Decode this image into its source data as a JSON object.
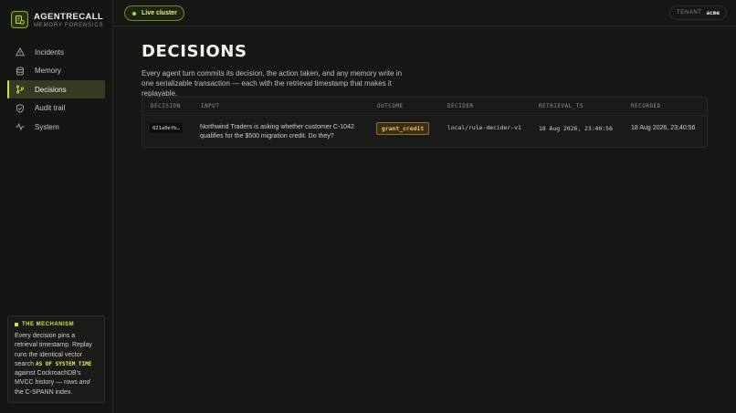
{
  "brand": {
    "name": "AGENTRECALL",
    "subtitle": "MEMORY FORENSICS",
    "accent": "#c8e63c"
  },
  "sidebar": {
    "items": [
      {
        "label": "Incidents",
        "icon": "warning-icon",
        "active": false
      },
      {
        "label": "Memory",
        "icon": "database-icon",
        "active": false
      },
      {
        "label": "Decisions",
        "icon": "git-branch-icon",
        "active": true
      },
      {
        "label": "Audit trail",
        "icon": "shield-check-icon",
        "active": false
      },
      {
        "label": "System",
        "icon": "activity-icon",
        "active": false
      }
    ]
  },
  "mechanism": {
    "title": "THE MECHANISM",
    "text_1": "Every decision pins a retrieval timestamp. Replay runs the identical vector search ",
    "code": "AS OF SYSTEM TIME",
    "text_2": " against CockroachDB's MVCC history — rows ",
    "em": "and",
    "text_3": " the C-SPANN index."
  },
  "topbar": {
    "live_label": "Live cluster",
    "tenant_label": "TENANT",
    "tenant_value": "acme"
  },
  "page": {
    "title": "DECISIONS",
    "description": "Every agent turn commits its decision, the action taken, and any memory write in one serializable transaction — each with the retrieval timestamp that makes it replayable."
  },
  "table": {
    "columns": [
      "DECISION",
      "INPUT",
      "OUTCOME",
      "DECIDER",
      "RETRIEVAL_TS",
      "RECORDED"
    ],
    "rows": [
      {
        "decision": "021a0efb…",
        "input": "Northwind Traders is asking whether customer C-1042 qualifies for the $500 migration credit. Do they?",
        "outcome": "grant_credit",
        "decider": "local/rule-decider-v1",
        "retrieval_ts": "18 Aug 2026, 23:40:56",
        "recorded": "18 Aug 2026, 23:40:56"
      }
    ]
  }
}
